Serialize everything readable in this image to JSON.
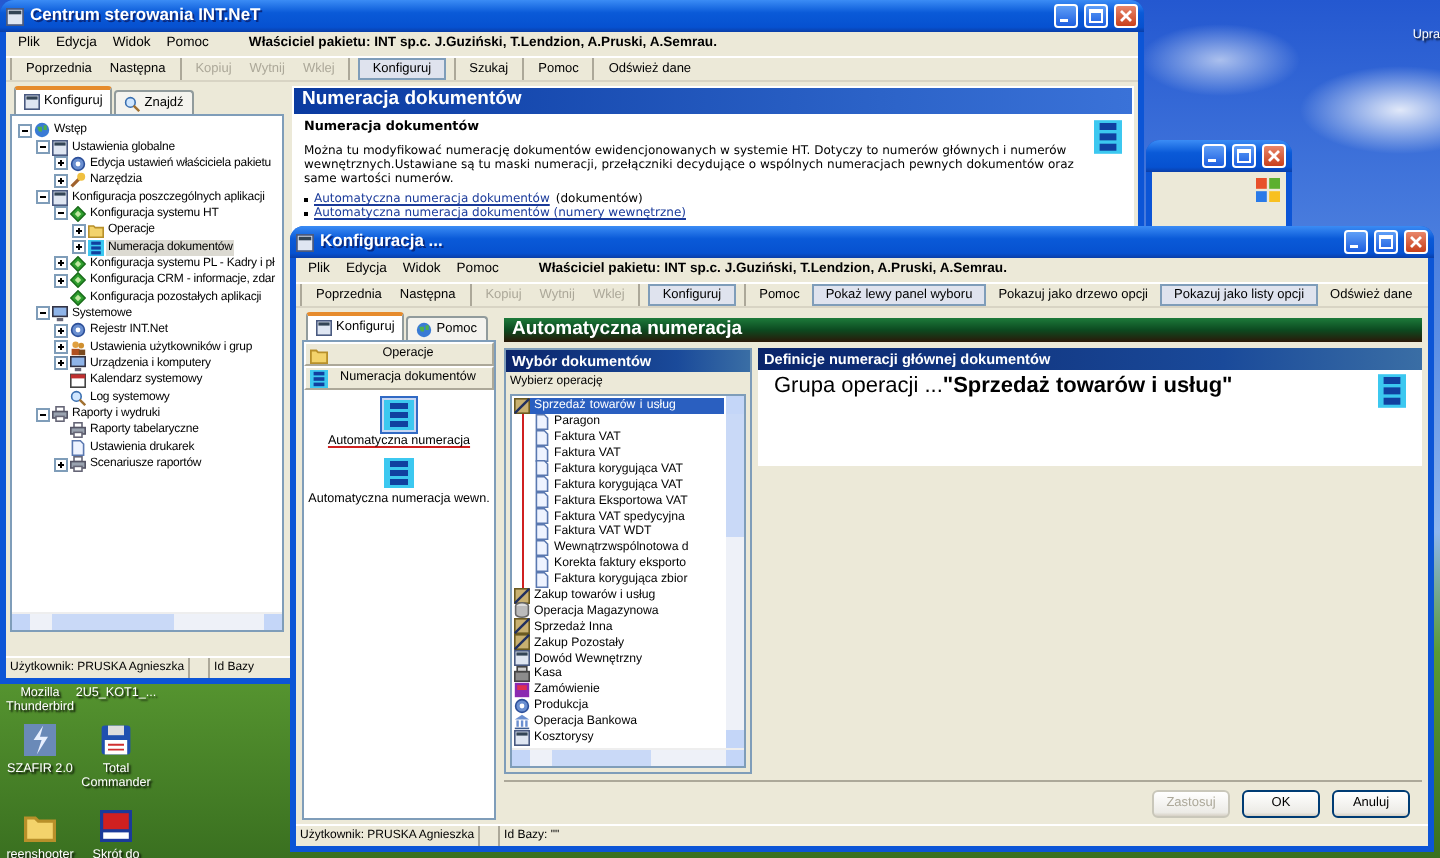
{
  "desktop": {
    "corner_label": "Upra",
    "icons": [
      {
        "label": "Mozilla Thunderbird"
      },
      {
        "label": "2U5_KOT1_..."
      },
      {
        "label": "SZAFIR 2.0",
        "kind": "bolt"
      },
      {
        "label": "Total Commander",
        "kind": "floppy"
      },
      {
        "label": "reenshooter",
        "kind": "folder"
      },
      {
        "label": "Skrót do",
        "kind": "tile"
      }
    ]
  },
  "main_window": {
    "title": "Centrum sterowania INT.NeT",
    "menu": [
      "Plik",
      "Edycja",
      "Widok",
      "Pomoc"
    ],
    "owner": "Właściciel pakietu: INT sp.c. J.Guziński, T.Lendzion, A.Pruski, A.Semrau.",
    "toolbar": [
      [
        {
          "label": "Poprzednia",
          "disabled": false,
          "pressed": false
        },
        {
          "label": "Następna",
          "disabled": false,
          "pressed": false
        }
      ],
      [
        {
          "label": "Kopiuj",
          "disabled": true,
          "pressed": false
        },
        {
          "label": "Wytnij",
          "disabled": true,
          "pressed": false
        },
        {
          "label": "Wklej",
          "disabled": true,
          "pressed": false
        }
      ],
      [
        {
          "label": "Konfiguruj",
          "disabled": false,
          "pressed": true
        }
      ],
      [
        {
          "label": "Szukaj",
          "disabled": false,
          "pressed": false
        }
      ],
      [
        {
          "label": "Pomoc",
          "disabled": false,
          "pressed": false
        }
      ],
      [
        {
          "label": "Odśwież dane",
          "disabled": false,
          "pressed": false
        }
      ]
    ],
    "tabs": [
      {
        "label": "Konfiguruj",
        "kind": "panel",
        "selected": true
      },
      {
        "label": "Znajdź",
        "kind": "magnifier",
        "selected": false
      }
    ],
    "tree": [
      {
        "label": "Wstęp",
        "kind": "globe",
        "expanded": true,
        "selected": false,
        "children": [
          {
            "label": "Ustawienia globalne",
            "kind": "panel",
            "expanded": true,
            "selected": false,
            "children": [
              {
                "label": "Edycja ustawień właściciela pakietu",
                "kind": "gear",
                "expanded": false,
                "selected": false
              },
              {
                "label": "Narzędzia",
                "kind": "wrench",
                "expanded": false,
                "selected": false
              }
            ]
          },
          {
            "label": "Konfiguracja poszczególnych aplikacji",
            "kind": "panel",
            "expanded": true,
            "selected": false,
            "children": [
              {
                "label": "Konfiguracja systemu HT",
                "kind": "diamond",
                "expanded": true,
                "selected": false,
                "children": [
                  {
                    "label": "Operacje",
                    "kind": "folder",
                    "expanded": false,
                    "selected": false
                  },
                  {
                    "label": "Numeracja dokumentów",
                    "kind": "numbering",
                    "expanded": false,
                    "selected": true
                  }
                ]
              },
              {
                "label": "Konfiguracja systemu PL - Kadry i pł",
                "kind": "diamond",
                "expanded": false,
                "selected": false
              },
              {
                "label": "Konfiguracja CRM - informacje, zdar",
                "kind": "diamond",
                "expanded": false,
                "selected": false
              },
              {
                "label": "Konfiguracja pozostałych aplikacji",
                "kind": "diamond",
                "selected": false
              }
            ]
          },
          {
            "label": "Systemowe",
            "kind": "computer",
            "expanded": true,
            "selected": false,
            "children": [
              {
                "label": "Rejestr INT.Net",
                "kind": "gear",
                "expanded": false,
                "selected": false
              },
              {
                "label": "Ustawienia użytkowników i grup",
                "kind": "users",
                "expanded": false,
                "selected": false
              },
              {
                "label": "Urządzenia i komputery",
                "kind": "computer",
                "expanded": false,
                "selected": false
              },
              {
                "label": "Kalendarz systemowy",
                "kind": "calendar",
                "selected": false
              },
              {
                "label": "Log systemowy",
                "kind": "magnifier",
                "selected": false
              }
            ]
          },
          {
            "label": "Raporty i wydruki",
            "kind": "printer",
            "expanded": true,
            "selected": false,
            "children": [
              {
                "label": "Raporty tabelaryczne",
                "kind": "printer",
                "selected": false
              },
              {
                "label": "Ustawienia drukarek",
                "kind": "document",
                "selected": false
              },
              {
                "label": "Scenariusze raportów",
                "kind": "printer",
                "expanded": false,
                "selected": false
              }
            ]
          }
        ]
      }
    ],
    "header": "Numeracja dokumentów",
    "content": {
      "heading": "Numeracja dokumentów",
      "paragraph": "Można tu modyfikować numerację dokumentów ewidencjonowanych w systemie HT. Dotyczy to numerów głównych i numerów wewnętrznych.Ustawiane są tu maski numeracji, przełączniki decydujące o wspólnych numeracjach pewnych dokumentów oraz same wartości numerów.",
      "links": [
        {
          "text": "Automatyczna numeracja dokumentów",
          "note": "(dokumentów)"
        },
        {
          "text": "Automatyczna numeracja dokumentów (numery wewnętrzne)"
        }
      ]
    },
    "status_bar": [
      "Użytkownik: PRUSKA Agnieszka",
      "Id Bazy"
    ]
  },
  "config_window": {
    "title": "Konfiguracja ...",
    "menu": [
      "Plik",
      "Edycja",
      "Widok",
      "Pomoc"
    ],
    "owner": "Właściciel pakietu: INT sp.c. J.Guziński, T.Lendzion, A.Pruski, A.Semrau.",
    "toolbar": [
      [
        {
          "label": "Poprzednia",
          "disabled": false,
          "pressed": false
        },
        {
          "label": "Następna",
          "disabled": false,
          "pressed": false
        }
      ],
      [
        {
          "label": "Kopiuj",
          "disabled": true,
          "pressed": false
        },
        {
          "label": "Wytnij",
          "disabled": true,
          "pressed": false
        },
        {
          "label": "Wklej",
          "disabled": true,
          "pressed": false
        }
      ],
      [
        {
          "label": "Konfiguruj",
          "disabled": false,
          "pressed": true
        }
      ],
      [
        {
          "label": "Pomoc",
          "disabled": false,
          "pressed": false
        },
        {
          "label": "Pokaż lewy panel wyboru",
          "disabled": false,
          "pressed": true
        },
        {
          "label": "Pokazuj jako drzewo opcji",
          "disabled": false,
          "pressed": false
        },
        {
          "label": "Pokazuj jako listy opcji",
          "disabled": false,
          "pressed": true
        },
        {
          "label": "Odśwież dane",
          "disabled": false,
          "pressed": false
        }
      ]
    ],
    "tabs": [
      {
        "label": "Konfiguruj",
        "kind": "panel",
        "selected": true
      },
      {
        "label": "Pomoc",
        "kind": "globe",
        "selected": false
      }
    ],
    "groups": [
      {
        "label": "Operacje",
        "kind": "folder"
      },
      {
        "label": "Numeracja dokumentów",
        "kind": "numbering"
      }
    ],
    "shortcuts": [
      {
        "label": "Automatyczna numeracja",
        "selected": true
      },
      {
        "label": "Automatyczna numeracja wewn.",
        "selected": false
      }
    ],
    "header": "Automatyczna numeracja",
    "selector": {
      "title": "Wybór dokumentów",
      "label": "Wybierz operację",
      "items": [
        {
          "label": "Sprzedaż towarów i usług",
          "kind": "goods",
          "expanded": true,
          "selected": true,
          "children": [
            {
              "label": "Paragon",
              "kind": "document",
              "selected": false
            },
            {
              "label": "Faktura VAT",
              "kind": "document",
              "selected": false
            },
            {
              "label": "Faktura VAT",
              "kind": "document",
              "selected": false
            },
            {
              "label": "Faktura korygująca VAT",
              "kind": "document",
              "selected": false
            },
            {
              "label": "Faktura korygująca VAT",
              "kind": "document",
              "selected": false
            },
            {
              "label": "Faktura Eksportowa VAT",
              "kind": "document",
              "selected": false
            },
            {
              "label": "Faktura VAT spedycyjna",
              "kind": "document",
              "selected": false
            },
            {
              "label": "Faktura VAT WDT",
              "kind": "document",
              "selected": false
            },
            {
              "label": "Wewnątrzwspólnotowa d",
              "kind": "document",
              "selected": false
            },
            {
              "label": "Korekta faktury eksporto",
              "kind": "document",
              "selected": false
            },
            {
              "label": "Faktura korygująca zbior",
              "kind": "document",
              "selected": false
            }
          ]
        },
        {
          "label": "Zakup towarów i usług",
          "kind": "goods",
          "selected": false
        },
        {
          "label": "Operacja Magazynowa",
          "kind": "cylinder",
          "selected": false
        },
        {
          "label": "Sprzedaż Inna",
          "kind": "goods",
          "selected": false
        },
        {
          "label": "Zakup Pozostały",
          "kind": "goods",
          "selected": false
        },
        {
          "label": "Dowód Wewnętrzny",
          "kind": "panel",
          "selected": false
        },
        {
          "label": "Kasa",
          "kind": "cash",
          "selected": false
        },
        {
          "label": "Zamówienie",
          "kind": "stamp",
          "selected": false
        },
        {
          "label": "Produkcja",
          "kind": "gear",
          "selected": false
        },
        {
          "label": "Operacja Bankowa",
          "kind": "bank",
          "selected": false
        },
        {
          "label": "Kosztorysy",
          "kind": "panel",
          "selected": false
        }
      ]
    },
    "definition": {
      "title": "Definicje numeracji głównej dokumentów",
      "text": "Grupa operacji ...**\"Sprzedaż towarów i usług\"**"
    },
    "buttons": [
      {
        "label": "Zastosuj",
        "disabled": true
      },
      {
        "label": "OK",
        "disabled": false
      },
      {
        "label": "Anuluj",
        "disabled": false
      }
    ],
    "status_bar": [
      "Użytkownik: PRUSKA Agnieszka",
      "Id Bazy: \"\""
    ]
  }
}
